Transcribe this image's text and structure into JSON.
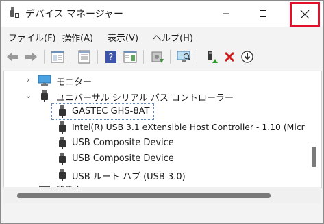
{
  "window": {
    "title": "デバイス マネージャー"
  },
  "menu": {
    "items": [
      "ファイル(F)",
      "操作(A)",
      "表示(V)",
      "ヘルプ(H)"
    ]
  },
  "toolbar": {
    "icons": [
      "back-arrow-icon",
      "forward-arrow-icon",
      "console-tree-icon",
      "properties-icon",
      "help-icon",
      "action-pane-icon",
      "update-driver-icon",
      "scan-hardware-icon",
      "enable-device-icon",
      "uninstall-icon",
      "download-icon"
    ]
  },
  "tree": {
    "monitor_label": "モニター",
    "usb_controllers_label": "ユニバーサル シリアル バス コントローラー",
    "devices": [
      "GASTEC GHS-8AT",
      "Intel(R) USB 3.1 eXtensible Host Controller - 1.10 (Micr",
      "USB Composite Device",
      "USB Composite Device",
      "USB ルート ハブ (USB 3.0)"
    ],
    "partial_label": "印刷キュー"
  },
  "colors": {
    "close_highlight": "#e0102a",
    "selection_outline": "#5a8ed0"
  }
}
